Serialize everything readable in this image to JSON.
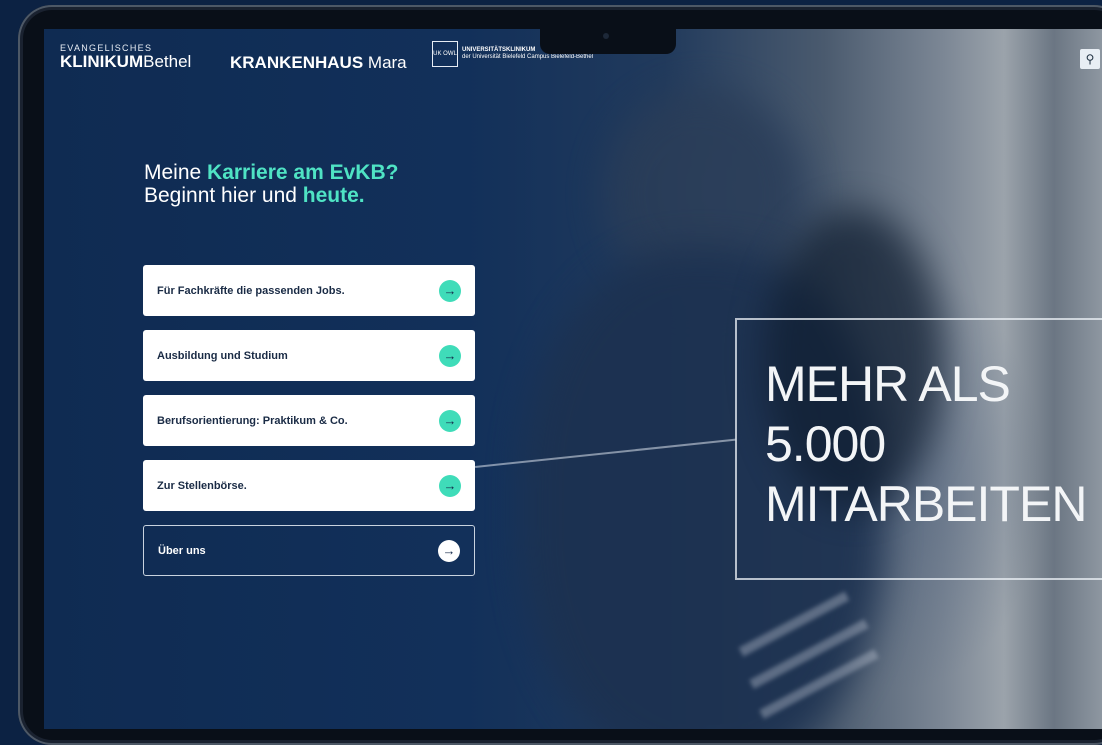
{
  "header": {
    "logo_evkb_small": "EVANGELISCHES",
    "logo_evkb_bold": "KLINIKUM",
    "logo_evkb_light": "Bethel",
    "logo_mara_bold": "KRANKENHAUS",
    "logo_mara_light": "Mara",
    "logo_uk_mark": "UK OWL",
    "logo_uk_title": "UNIVERSITÄTSKLINIKUM",
    "logo_uk_sub": "der Universität Bielefeld Campus Bielefeld-Bethel",
    "search_icon": "search-icon"
  },
  "hero": {
    "line1_plain": "Meine ",
    "line1_highlight": "Karriere am EvKB?",
    "line2_plain": "Beginnt hier und ",
    "line2_highlight": "heute."
  },
  "actions": [
    {
      "label": "Für Fachkräfte die passenden Jobs."
    },
    {
      "label": "Ausbildung und Studium"
    },
    {
      "label": "Berufsorientierung: Praktikum & Co."
    },
    {
      "label": "Zur Stellenbörse."
    },
    {
      "label": "Über uns"
    }
  ],
  "stat": {
    "line1": "MEHR ALS",
    "line2": "5.000",
    "line3": "MITARBEITEN"
  },
  "colors": {
    "accent": "#3fdcb9",
    "background": "#0c2243",
    "text_dark": "#1a2b45"
  }
}
